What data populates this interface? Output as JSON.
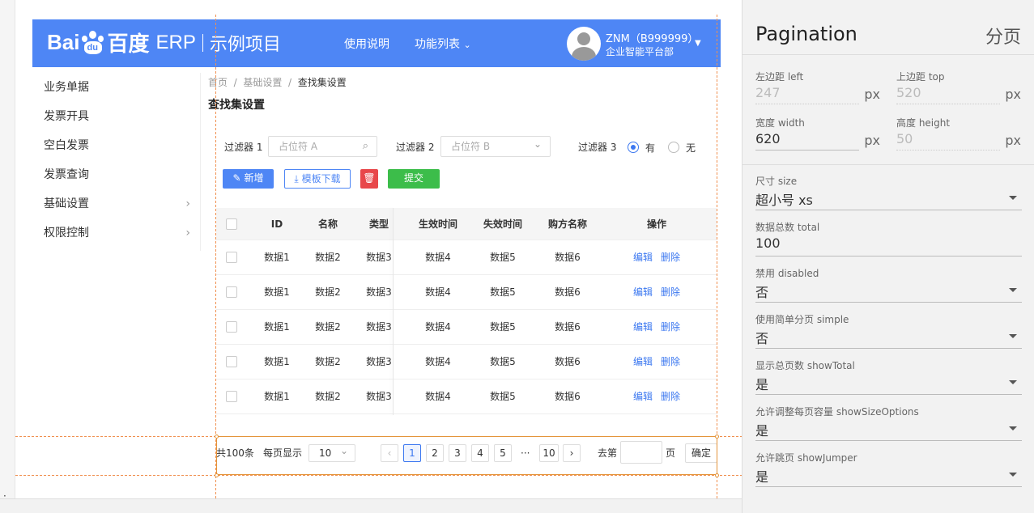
{
  "app": {
    "logo_text_left": "Bai",
    "logo_text_mid": "du",
    "logo_text_right": "百度",
    "logo_erp": "ERP",
    "project": "示例项目",
    "nav_help": "使用说明",
    "nav_functions": "功能列表",
    "user_name": "ZNM（B999999）",
    "user_dept": "企业智能平台部"
  },
  "sidebar": {
    "items": [
      {
        "label": "业务单据"
      },
      {
        "label": "发票开具"
      },
      {
        "label": "空白发票"
      },
      {
        "label": "发票查询"
      },
      {
        "label": "基础设置"
      },
      {
        "label": "权限控制"
      }
    ]
  },
  "breadcrumb": {
    "home": "首页",
    "sep": "/",
    "level1": "基础设置",
    "current": "查找集设置"
  },
  "page_title": "查找集设置",
  "filters": {
    "f1_label": "过滤器 1",
    "f1_placeholder": "占位符 A",
    "f2_label": "过滤器 2",
    "f2_placeholder": "占位符 B",
    "f3_label": "过滤器 3",
    "opt_yes": "有",
    "opt_no": "无"
  },
  "toolbar": {
    "add": "新增",
    "template": "模板下载",
    "submit": "提交"
  },
  "table": {
    "headers": [
      "ID",
      "名称",
      "类型",
      "生效时间",
      "失效时间",
      "购方名称",
      "操作"
    ],
    "rows": [
      [
        "数据1",
        "数据2",
        "数据3",
        "数据4",
        "数据5",
        "数据6"
      ],
      [
        "数据1",
        "数据2",
        "数据3",
        "数据4",
        "数据5",
        "数据6"
      ],
      [
        "数据1",
        "数据2",
        "数据3",
        "数据4",
        "数据5",
        "数据6"
      ],
      [
        "数据1",
        "数据2",
        "数据3",
        "数据4",
        "数据5",
        "数据6"
      ],
      [
        "数据1",
        "数据2",
        "数据3",
        "数据4",
        "数据5",
        "数据6"
      ]
    ],
    "edit": "编辑",
    "delete": "删除"
  },
  "pagination": {
    "total": "共100条",
    "per_page_label": "每页显示",
    "per_page_value": "10",
    "pages": [
      "1",
      "2",
      "3",
      "4",
      "5"
    ],
    "ellipsis": "···",
    "last": "10",
    "current": "1",
    "goto": "去第",
    "page_unit": "页",
    "confirm": "确定"
  },
  "panel": {
    "title": "Pagination",
    "subtitle": "分页",
    "left_label": "左边距 left",
    "left_value": "247",
    "top_label": "上边距 top",
    "top_value": "520",
    "width_label": "宽度 width",
    "width_value": "620",
    "height_label": "高度 height",
    "height_value": "50",
    "unit": "px",
    "size_label": "尺寸 size",
    "size_value": "超小号 xs",
    "total_label": "数据总数 total",
    "total_value": "100",
    "disabled_label": "禁用 disabled",
    "disabled_value": "否",
    "simple_label": "使用简单分页 simple",
    "simple_value": "否",
    "showtotal_label": "显示总页数 showTotal",
    "showtotal_value": "是",
    "sizeopts_label": "允许调整每页容量 showSizeOptions",
    "sizeopts_value": "是",
    "jumper_label": "允许跳页 showJumper",
    "jumper_value": "是"
  },
  "colors": {
    "accent": "#4e86f5",
    "danger": "#e8474a",
    "success": "#3cbd4a",
    "guide": "#f09050"
  }
}
